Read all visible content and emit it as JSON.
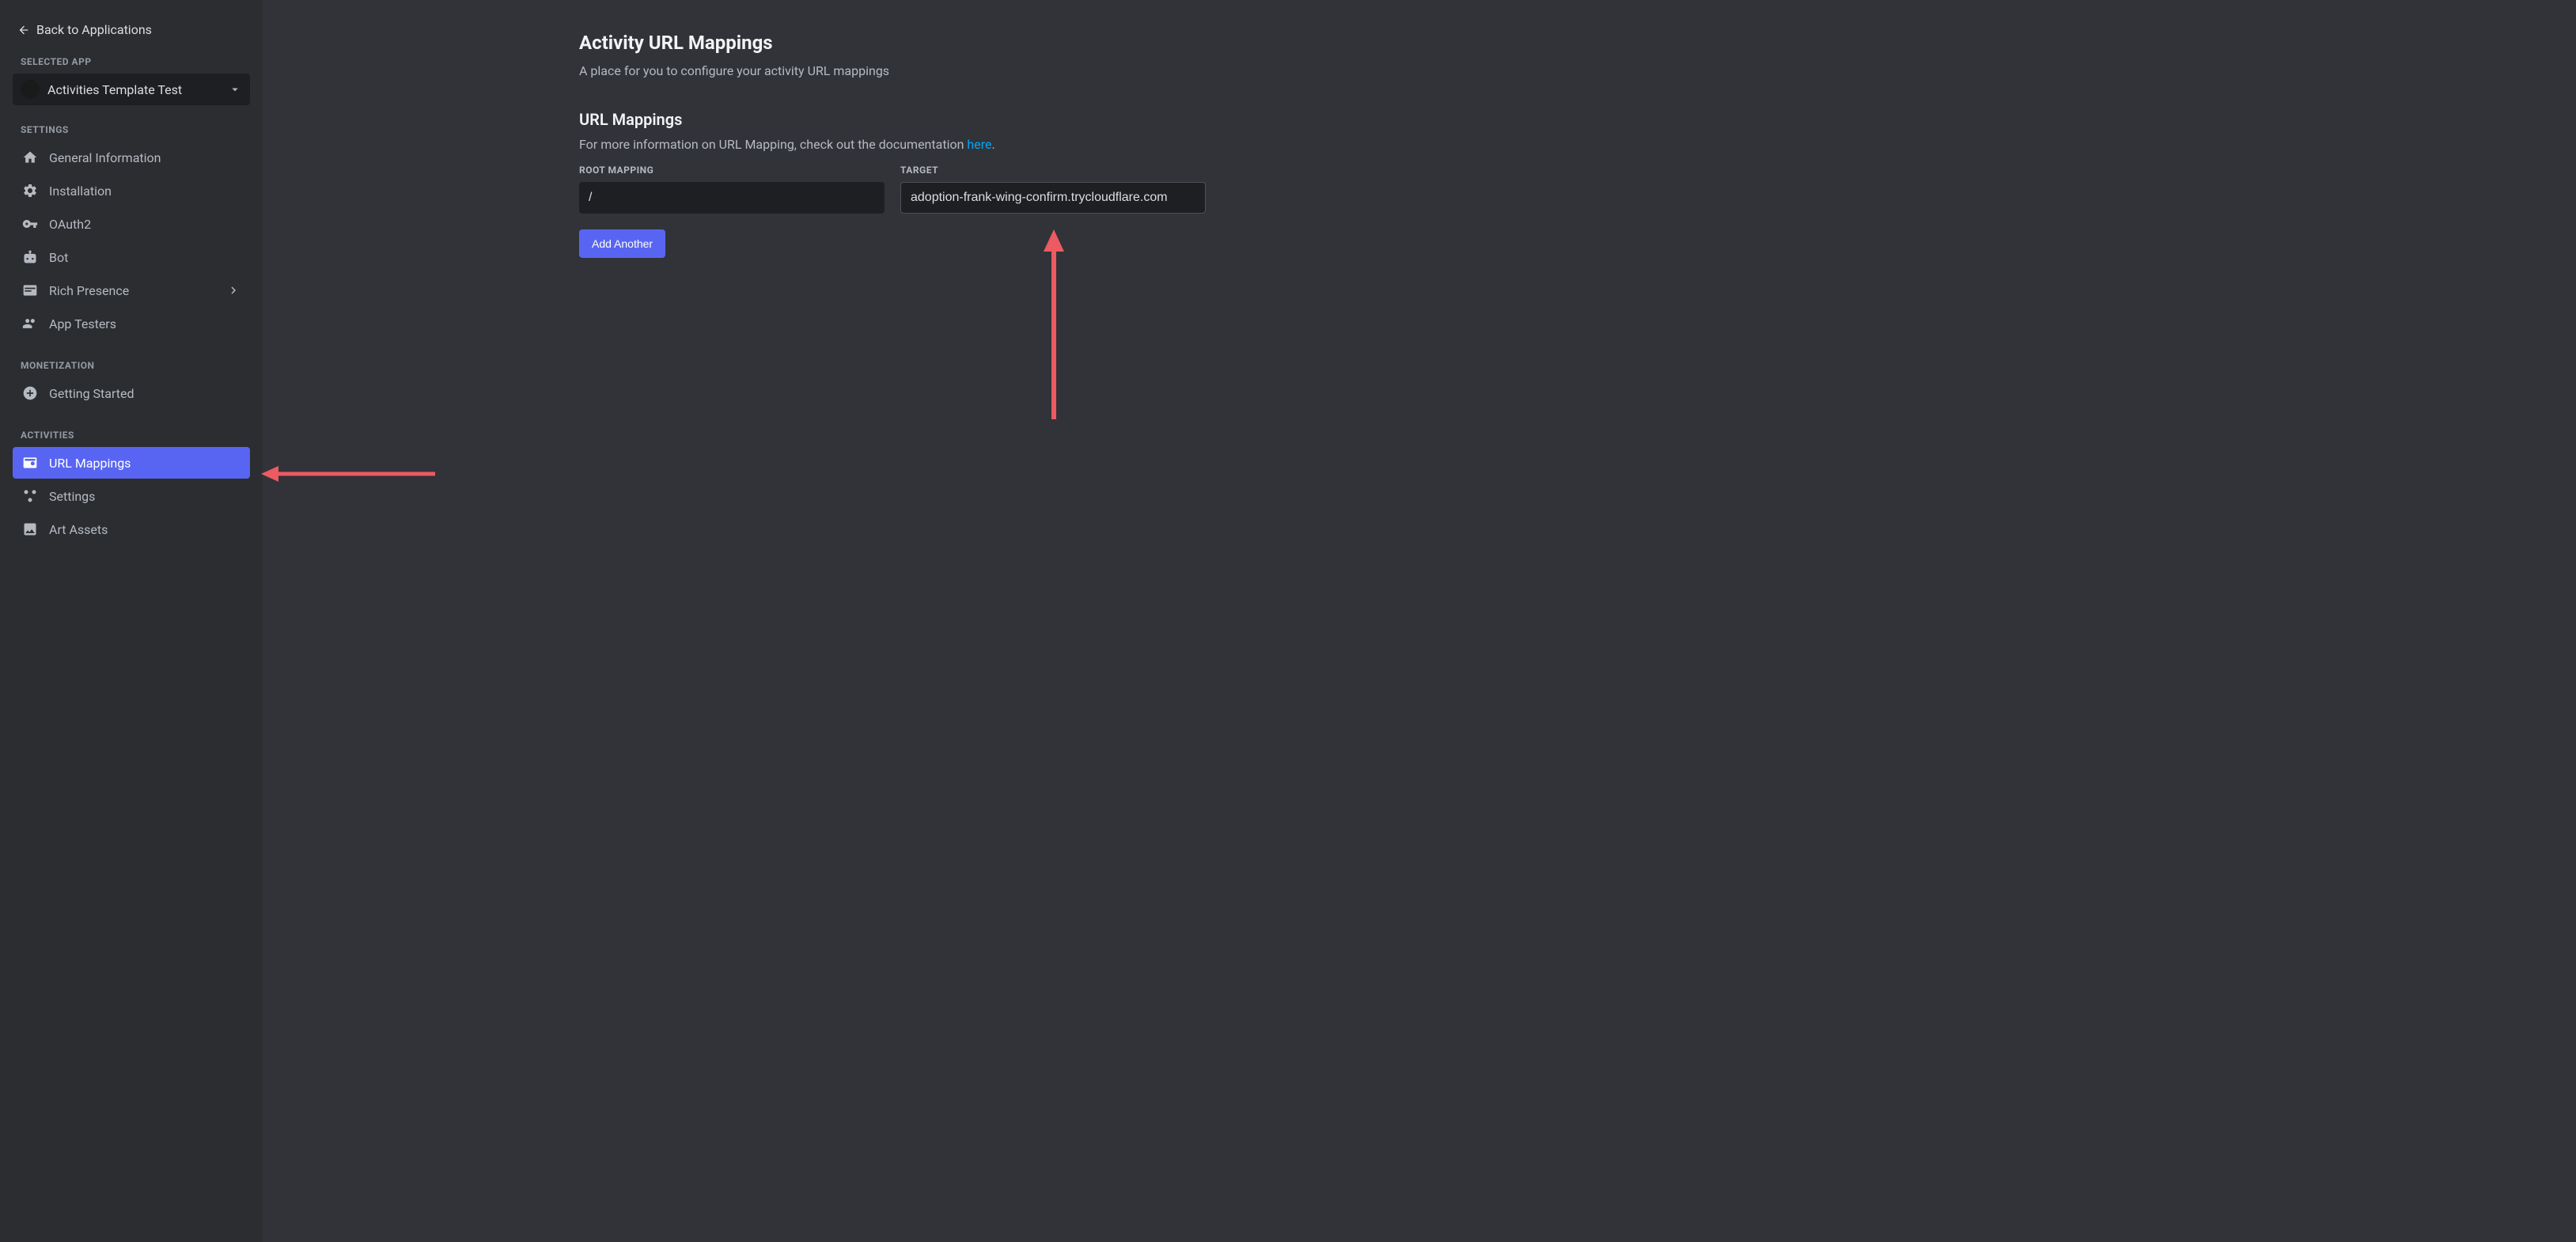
{
  "sidebar": {
    "back_label": "Back to Applications",
    "selected_app_label": "Selected App",
    "app_name": "Activities Template Test",
    "sections": {
      "settings": {
        "label": "Settings",
        "items": [
          {
            "label": "General Information",
            "icon": "home"
          },
          {
            "label": "Installation",
            "icon": "gear"
          },
          {
            "label": "OAuth2",
            "icon": "key"
          },
          {
            "label": "Bot",
            "icon": "robot"
          },
          {
            "label": "Rich Presence",
            "icon": "card",
            "has_chevron": true
          },
          {
            "label": "App Testers",
            "icon": "people"
          }
        ]
      },
      "monetization": {
        "label": "Monetization",
        "items": [
          {
            "label": "Getting Started",
            "icon": "plus-circle"
          }
        ]
      },
      "activities": {
        "label": "Activities",
        "items": [
          {
            "label": "URL Mappings",
            "icon": "url-card",
            "active": true
          },
          {
            "label": "Settings",
            "icon": "nodes"
          },
          {
            "label": "Art Assets",
            "icon": "image"
          }
        ]
      }
    }
  },
  "main": {
    "title": "Activity URL Mappings",
    "subtitle": "A place for you to configure your activity URL mappings",
    "section_title": "URL Mappings",
    "section_desc_prefix": "For more information on URL Mapping, check out the documentation ",
    "section_desc_link": "here",
    "section_desc_suffix": ".",
    "root_mapping_label": "Root Mapping",
    "target_label": "Target",
    "root_mapping_value": "/",
    "target_value": "adoption-frank-wing-confirm.trycloudflare.com",
    "add_another_label": "Add Another"
  },
  "annotations": {
    "arrow_color": "#ec5a62"
  }
}
